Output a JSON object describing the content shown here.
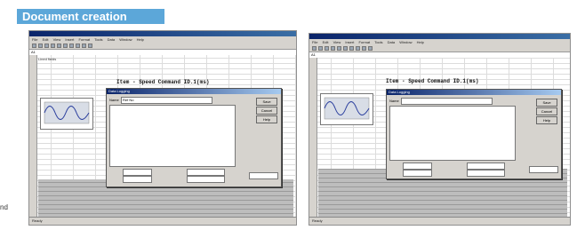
{
  "badge": {
    "label": "Document creation"
  },
  "side": {
    "text": "nd"
  },
  "screenshots": [
    {
      "menu": [
        "File",
        "Edit",
        "View",
        "Insert",
        "Format",
        "Tools",
        "Data",
        "Window",
        "Help"
      ],
      "cell_ref": "A1",
      "corner_label": "Lined fields",
      "sheet_title": "Item - Speed Command  ID.1(ms)",
      "dialog_title": "Data Logging",
      "dialog_name_label": "Name",
      "dialog_field1": "Ref No",
      "dialog_list_item": "",
      "dialog_buttons": [
        "Save",
        "Cancel",
        "Help"
      ],
      "status": "Ready"
    },
    {
      "menu": [
        "File",
        "Edit",
        "View",
        "Insert",
        "Format",
        "Tools",
        "Data",
        "Window",
        "Help"
      ],
      "cell_ref": "A1",
      "corner_label": "",
      "sheet_title": "Item - Speed Command  ID.1(ms)",
      "dialog_title": "Data Logging",
      "dialog_name_label": "Name",
      "dialog_field1": "",
      "dialog_list_item": "",
      "dialog_buttons": [
        "Save",
        "Cancel",
        "Help"
      ],
      "status": "Ready"
    }
  ],
  "colors": {
    "badge": "#5ca7d9",
    "titlebar": "#0a246a",
    "window": "#d6d3ce"
  }
}
